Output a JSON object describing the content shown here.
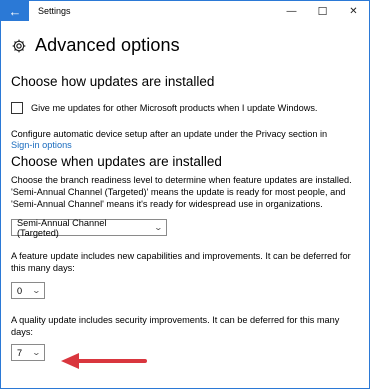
{
  "window": {
    "title": "Settings",
    "back_glyph": "←",
    "minimize_glyph": "—",
    "maximize_glyph": "☐",
    "close_glyph": "✕"
  },
  "header": {
    "icon": "gear-icon",
    "title": "Advanced options"
  },
  "install_section": {
    "heading": "Choose how updates are installed",
    "checkbox_label": "Give me updates for other Microsoft products when I update Windows.",
    "checkbox_checked": false,
    "privacy_text": "Configure automatic device setup after an update under the Privacy section in",
    "privacy_link": "Sign-in options"
  },
  "when_section": {
    "heading": "Choose when updates are installed",
    "description_lines": [
      "Choose the branch readiness level to determine when feature updates are installed.",
      "'Semi-Annual Channel (Targeted)' means the update is ready for most people, and",
      "'Semi-Annual Channel' means it's ready for widespread use in organizations."
    ],
    "channel_value": "Semi-Annual Channel (Targeted)",
    "feature_text_lines": [
      "A feature update includes new capabilities and improvements. It can be deferred for",
      "this many days:"
    ],
    "feature_days": "0",
    "quality_text": "A quality update includes security improvements. It can be deferred for this many days:",
    "quality_days": "7"
  },
  "colors": {
    "accent": "#2b79d6",
    "link": "#1a6cbf",
    "arrow": "#d9363e"
  }
}
